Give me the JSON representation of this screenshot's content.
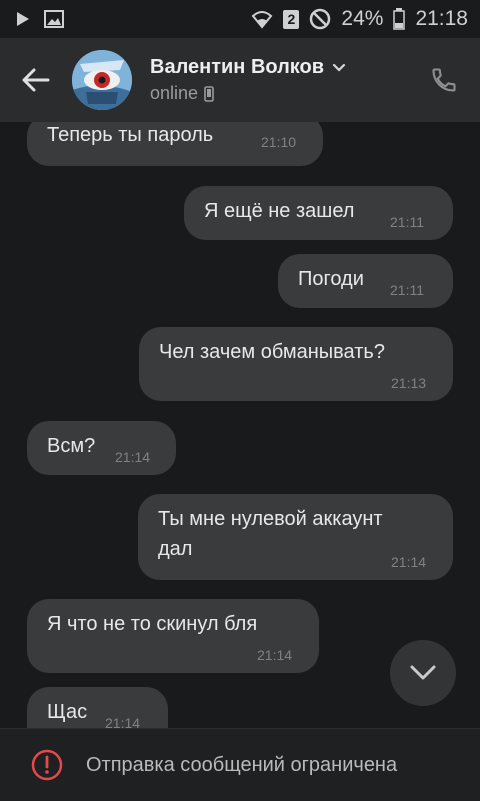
{
  "status_bar": {
    "battery": "24%",
    "time": "21:18",
    "sim_badge": "2"
  },
  "header": {
    "contact_name": "Валентин Волков",
    "status": "online"
  },
  "messages": [
    {
      "direction": "in",
      "text": "Теперь ты пароль",
      "time": "21:10"
    },
    {
      "direction": "out",
      "text": "Я ещё не зашел",
      "time": "21:11"
    },
    {
      "direction": "out",
      "text": "Погоди",
      "time": "21:11"
    },
    {
      "direction": "out",
      "text": "Чел зачем обманывать?",
      "time": "21:13"
    },
    {
      "direction": "in",
      "text": "Всм?",
      "time": "21:14"
    },
    {
      "direction": "out",
      "text_line1": "Ты мне нулевой аккаунт",
      "text_line2": "дал",
      "time": "21:14"
    },
    {
      "direction": "in",
      "text": "Я что не то скинул бля",
      "time": "21:14"
    },
    {
      "direction": "in",
      "text": "Щас",
      "time": "21:14"
    }
  ],
  "footer": {
    "notice": "Отправка сообщений ограничена"
  },
  "colors": {
    "background": "#191a1c",
    "header": "#2b2c2e",
    "bubble": "#3a3b3d"
  }
}
